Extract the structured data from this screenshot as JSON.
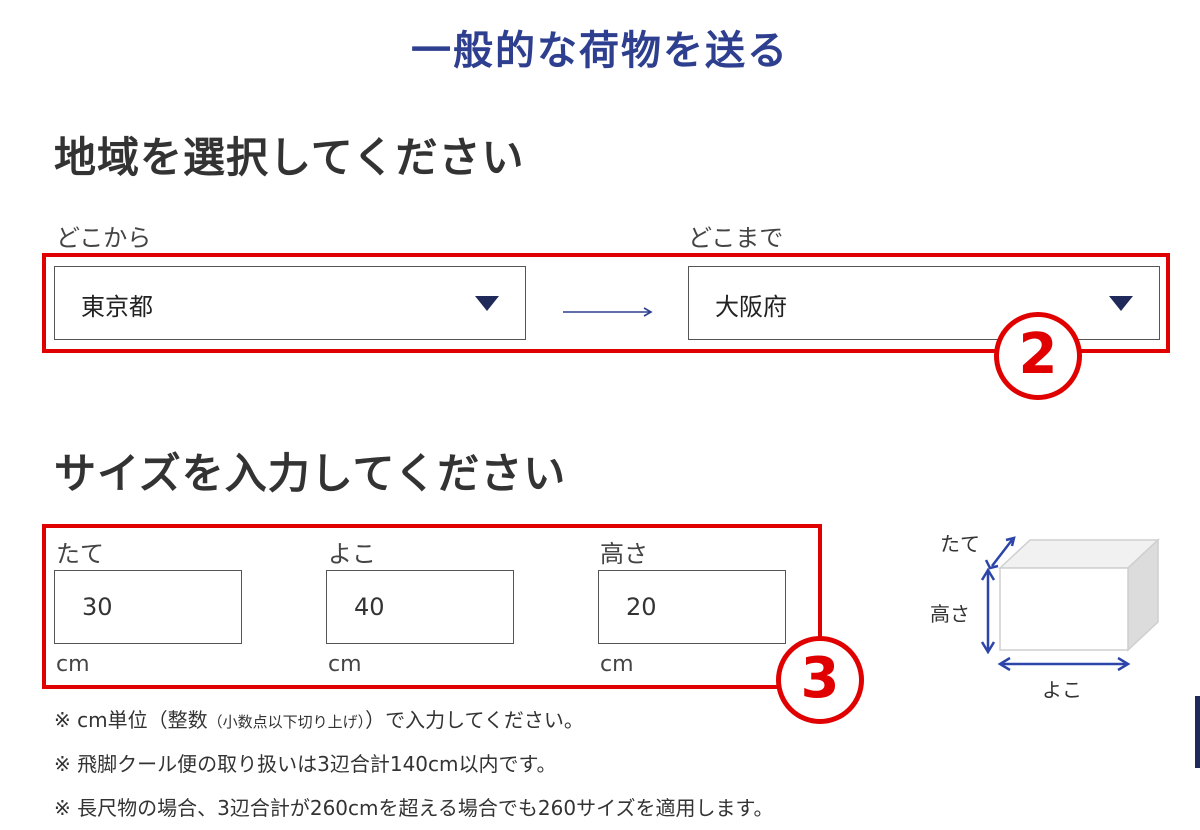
{
  "page": {
    "title": "一般的な荷物を送る"
  },
  "region": {
    "heading": "地域を選択してください",
    "from_label": "どこから",
    "to_label": "どこまで",
    "from_value": "東京都",
    "to_value": "大阪府",
    "step_badge": "2"
  },
  "size": {
    "heading": "サイズを入力してください",
    "fields": [
      {
        "label": "たて",
        "value": "30",
        "unit": "cm"
      },
      {
        "label": "よこ",
        "value": "40",
        "unit": "cm"
      },
      {
        "label": "高さ",
        "value": "20",
        "unit": "cm"
      }
    ],
    "step_badge": "3",
    "diagram": {
      "label_depth": "たて",
      "label_height": "高さ",
      "label_width": "よこ"
    }
  },
  "notes": {
    "note1_prefix": "※ cm単位（整数",
    "note1_small": "（小数点以下切り上げ）",
    "note1_suffix": "）で入力してください。",
    "note2": "※ 飛脚クール便の取り扱いは3辺合計140cm以内です。",
    "note3": "※ 長尺物の場合、3辺合計が260cmを超える場合でも260サイズを適用します。"
  },
  "colors": {
    "title_blue": "#2e3f8f",
    "highlight_red": "#e00000",
    "arrow_blue": "#2e3f8f",
    "caret_navy": "#1f2a5a"
  }
}
